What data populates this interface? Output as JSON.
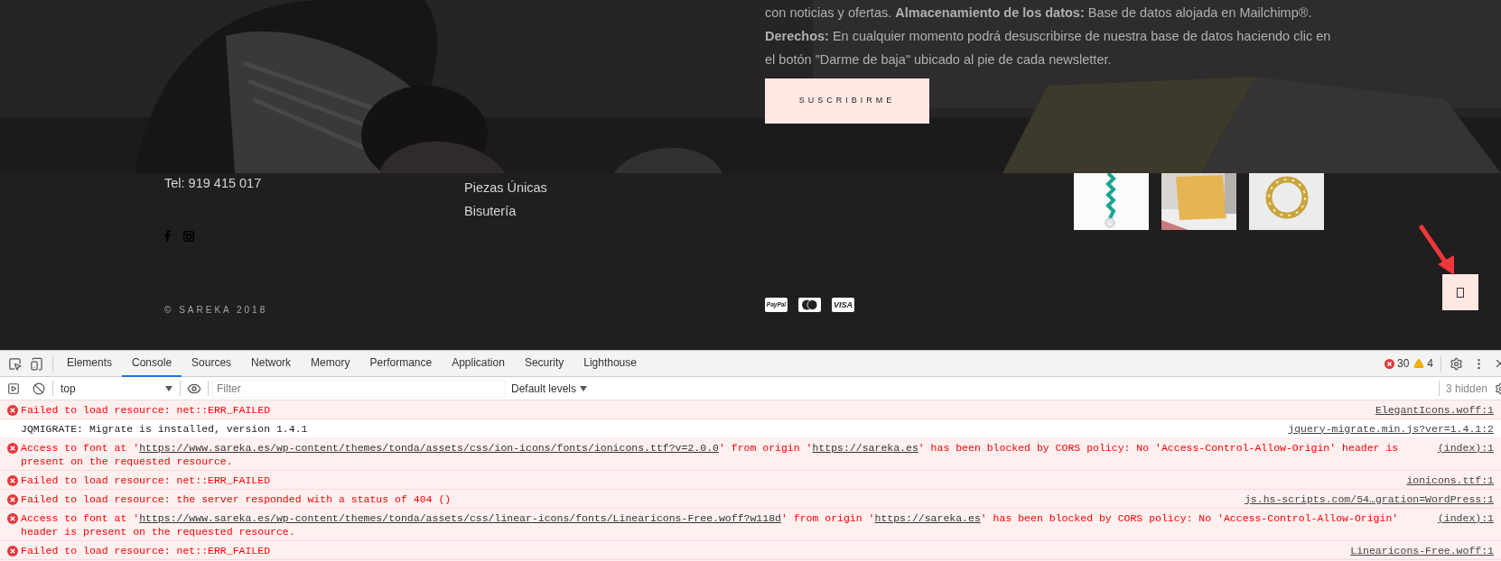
{
  "hero": {
    "paragraphs": [
      "con noticias y ofertas. **Almacenamiento de los datos:** Base de datos alojada en Mailchimp®.",
      "**Derechos:** En cualquier momento podrá desuscribirse de nuestra base de datos haciendo clic en el botón \"Darme de baja\" ubicado al pie de cada newsletter."
    ],
    "button": "SUSCRIBIRME"
  },
  "footer": {
    "phone": "Tel: 919 415 017",
    "links": [
      "Piezas Únicas",
      "Bisutería"
    ],
    "copyright": "© SAREKA 2018",
    "payment_methods": [
      {
        "kind": "paypal",
        "label": "PayPal"
      },
      {
        "kind": "mastercard"
      },
      {
        "kind": "visa",
        "label": "VISA"
      }
    ],
    "gallery": [
      {
        "kind": "bracelet"
      },
      {
        "kind": "pillow"
      },
      {
        "kind": "wreath"
      }
    ]
  },
  "devtools": {
    "tabs": [
      {
        "label": "Elements",
        "selected": false
      },
      {
        "label": "Console",
        "selected": true
      },
      {
        "label": "Sources",
        "selected": false
      },
      {
        "label": "Network",
        "selected": false
      },
      {
        "label": "Memory",
        "selected": false
      },
      {
        "label": "Performance",
        "selected": false
      },
      {
        "label": "Application",
        "selected": false
      },
      {
        "label": "Security",
        "selected": false
      },
      {
        "label": "Lighthouse",
        "selected": false
      }
    ],
    "error_count": "30",
    "warning_count": "4",
    "context": "top",
    "filter_placeholder": "Filter",
    "levels": "Default levels",
    "hidden": "3 hidden",
    "messages": [
      {
        "kind": "error",
        "segments": [
          {
            "kind": "text",
            "text": "Failed to load resource: net::ERR_FAILED"
          }
        ],
        "source": "ElegantIcons.woff:1"
      },
      {
        "kind": "log",
        "segments": [
          {
            "kind": "text",
            "text": "JQMIGRATE: Migrate is installed, version 1.4.1"
          }
        ],
        "source": "jquery-migrate.min.js?ver=1.4.1:2"
      },
      {
        "kind": "error",
        "segments": [
          {
            "kind": "text",
            "text": "Access to font at '"
          },
          {
            "kind": "link",
            "text": "https://www.sareka.es/wp-content/themes/tonda/assets/css/ion-icons/fonts/ionicons.ttf?v=2.0.0"
          },
          {
            "kind": "text",
            "text": "' from origin '"
          },
          {
            "kind": "link",
            "text": "https://sareka.es"
          },
          {
            "kind": "text",
            "text": "' has been blocked by CORS policy: No 'Access-Control-Allow-Origin' header is present on the requested resource."
          }
        ],
        "source": "(index):1"
      },
      {
        "kind": "error",
        "segments": [
          {
            "kind": "text",
            "text": "Failed to load resource: net::ERR_FAILED"
          }
        ],
        "source": "ionicons.ttf:1"
      },
      {
        "kind": "error",
        "segments": [
          {
            "kind": "text",
            "text": "Failed to load resource: the server responded with a status of 404 ()"
          }
        ],
        "source": "js.hs-scripts.com/54…gration=WordPress:1"
      },
      {
        "kind": "error",
        "segments": [
          {
            "kind": "text",
            "text": "Access to font at '"
          },
          {
            "kind": "link",
            "text": "https://www.sareka.es/wp-content/themes/tonda/assets/css/linear-icons/fonts/Linearicons-Free.woff?w118d"
          },
          {
            "kind": "text",
            "text": "' from origin '"
          },
          {
            "kind": "link",
            "text": "https://sareka.es"
          },
          {
            "kind": "text",
            "text": "' has been blocked by CORS policy: No 'Access-Control-Allow-Origin' header is present on the requested resource."
          }
        ],
        "source": "(index):1"
      },
      {
        "kind": "error",
        "segments": [
          {
            "kind": "text",
            "text": "Failed to load resource: net::ERR_FAILED"
          }
        ],
        "source": "Linearicons-Free.woff:1"
      }
    ]
  }
}
